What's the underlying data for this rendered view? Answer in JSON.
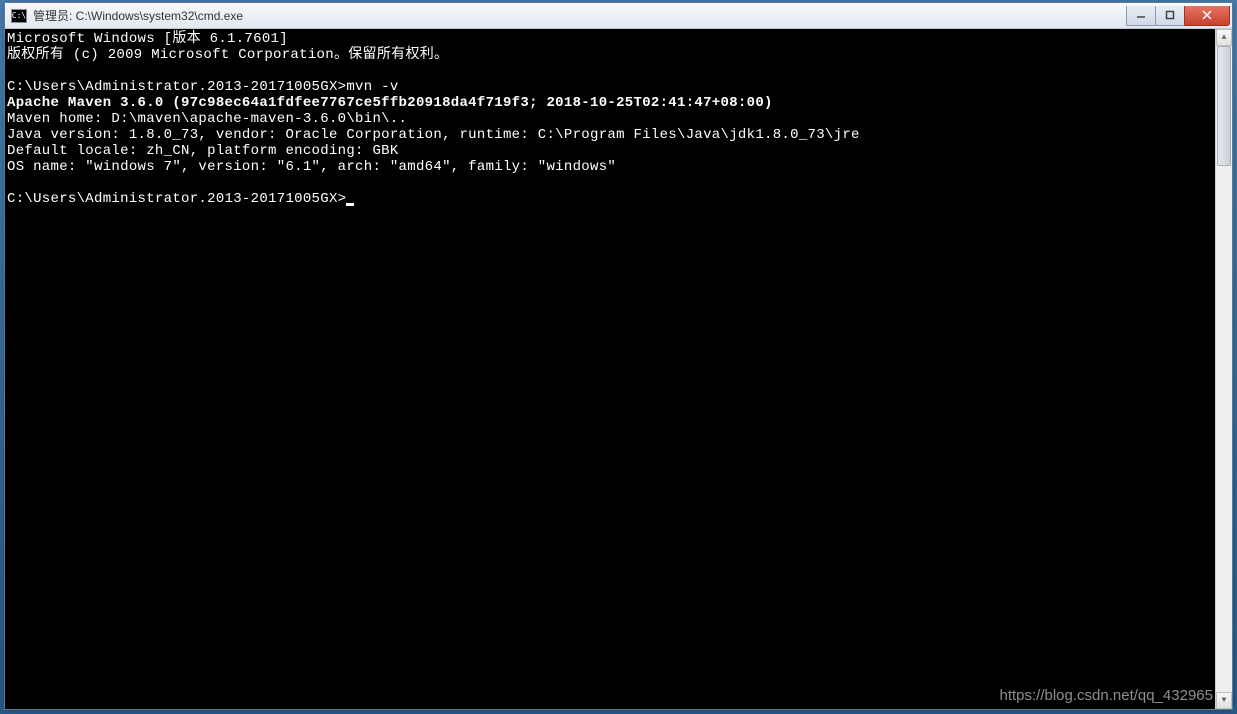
{
  "titlebar": {
    "icon_label": "C:\\",
    "text": "管理员: C:\\Windows\\system32\\cmd.exe"
  },
  "console": {
    "line_version": "Microsoft Windows [版本 6.1.7601]",
    "line_copyright": "版权所有 (c) 2009 Microsoft Corporation。保留所有权利。",
    "prompt1": "C:\\Users\\Administrator.2013-20171005GX>mvn -v",
    "line_maven": "Apache Maven 3.6.0 (97c98ec64a1fdfee7767ce5ffb20918da4f719f3; 2018-10-25T02:41:47+08:00)",
    "line_maven_home": "Maven home: D:\\maven\\apache-maven-3.6.0\\bin\\..",
    "line_java": "Java version: 1.8.0_73, vendor: Oracle Corporation, runtime: C:\\Program Files\\Java\\jdk1.8.0_73\\jre",
    "line_locale": "Default locale: zh_CN, platform encoding: GBK",
    "line_os": "OS name: \"windows 7\", version: \"6.1\", arch: \"amd64\", family: \"windows\"",
    "prompt2": "C:\\Users\\Administrator.2013-20171005GX>"
  },
  "watermark": "https://blog.csdn.net/qq_432965"
}
